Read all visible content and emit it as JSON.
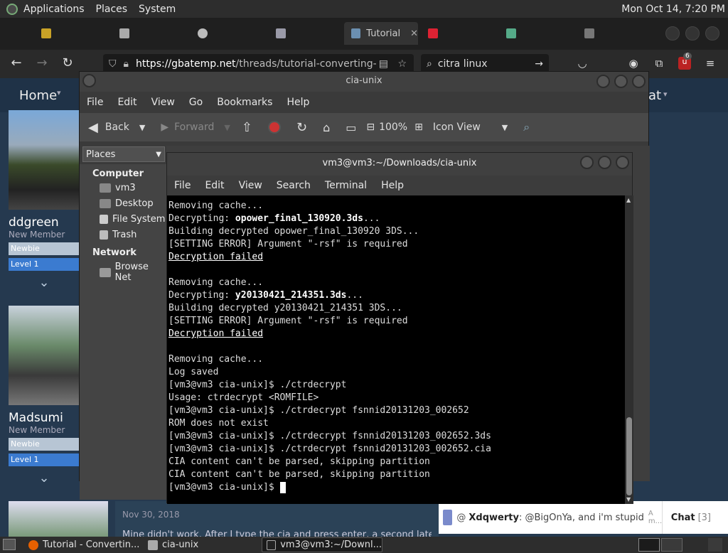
{
  "panel": {
    "menus": [
      "Applications",
      "Places",
      "System"
    ],
    "clock": "Mon Oct 14,  7:20 PM"
  },
  "browser": {
    "active_tab_label": "Tutorial",
    "url_host": "https://gbatemp.net",
    "url_path": "/threads/tutorial-converting-",
    "search_text": "citra linux",
    "notification_count": "6"
  },
  "forum": {
    "nav_home": "Home",
    "nav_right": "at",
    "members": [
      {
        "name": "ddgreen",
        "role": "New Member",
        "badge1": "Newbie",
        "badge2": "Level 1"
      },
      {
        "name": "Madsumi",
        "role": "New Member",
        "badge1": "Newbie",
        "badge2": "Level 1"
      }
    ],
    "post_date": "Nov 30, 2018",
    "post_text": "Mine didn't work. After I type the cia and press enter, a second later it ap",
    "chat_user": "Xdqwerty",
    "chat_msg": ": @BigOnYa, and i'm stupid",
    "chat_time": "A m...",
    "chat_label": "Chat",
    "chat_count": "[3]"
  },
  "file_manager": {
    "title": "cia-unix",
    "menus": [
      "File",
      "Edit",
      "View",
      "Go",
      "Bookmarks",
      "Help"
    ],
    "toolbar": {
      "back": "Back",
      "forward": "Forward",
      "zoom": "100%",
      "view_mode": "Icon View"
    },
    "places_label": "Places",
    "sidebar": {
      "computer_header": "Computer",
      "computer_items": [
        "vm3",
        "Desktop",
        "File System",
        "Trash"
      ],
      "network_header": "Network",
      "network_items": [
        "Browse Net"
      ]
    }
  },
  "terminal": {
    "title": "vm3@vm3:~/Downloads/cia-unix",
    "menus": [
      "File",
      "Edit",
      "View",
      "Search",
      "Terminal",
      "Help"
    ],
    "lines": [
      {
        "pre": "Removing cache...",
        "bold": "",
        "post": ""
      },
      {
        "pre": "Decrypting: ",
        "bold": "opower_final_130920.3ds",
        "post": "..."
      },
      {
        "pre": "Building decrypted opower_final_130920 3DS...",
        "bold": "",
        "post": ""
      },
      {
        "pre": "[SETTING ERROR] Argument \"-rsf\" is required",
        "bold": "",
        "post": ""
      },
      {
        "pre": "",
        "bold": "",
        "post": "",
        "underline": "Decryption failed"
      },
      {
        "pre": "",
        "bold": "",
        "post": ""
      },
      {
        "pre": "Removing cache...",
        "bold": "",
        "post": ""
      },
      {
        "pre": "Decrypting: ",
        "bold": "y20130421_214351.3ds",
        "post": "..."
      },
      {
        "pre": "Building decrypted y20130421_214351 3DS...",
        "bold": "",
        "post": ""
      },
      {
        "pre": "[SETTING ERROR] Argument \"-rsf\" is required",
        "bold": "",
        "post": ""
      },
      {
        "pre": "",
        "bold": "",
        "post": "",
        "underline": "Decryption failed"
      },
      {
        "pre": "",
        "bold": "",
        "post": ""
      },
      {
        "pre": "Removing cache...",
        "bold": "",
        "post": ""
      },
      {
        "pre": "Log saved",
        "bold": "",
        "post": ""
      },
      {
        "pre": "[vm3@vm3 cia-unix]$ ./ctrdecrypt",
        "bold": "",
        "post": ""
      },
      {
        "pre": "Usage: ctrdecrypt <ROMFILE>",
        "bold": "",
        "post": ""
      },
      {
        "pre": "[vm3@vm3 cia-unix]$ ./ctrdecrypt fsnnid20131203_002652",
        "bold": "",
        "post": ""
      },
      {
        "pre": "ROM does not exist",
        "bold": "",
        "post": ""
      },
      {
        "pre": "[vm3@vm3 cia-unix]$ ./ctrdecrypt fsnnid20131203_002652.3ds",
        "bold": "",
        "post": ""
      },
      {
        "pre": "[vm3@vm3 cia-unix]$ ./ctrdecrypt fsnnid20131203_002652.cia",
        "bold": "",
        "post": ""
      },
      {
        "pre": "CIA content can't be parsed, skipping partition",
        "bold": "",
        "post": ""
      },
      {
        "pre": "CIA content can't be parsed, skipping partition",
        "bold": "",
        "post": ""
      },
      {
        "pre": "[vm3@vm3 cia-unix]$ ",
        "bold": "",
        "post": "",
        "cursor": true
      }
    ]
  },
  "taskbar": {
    "items": [
      "Tutorial - Convertin...",
      "cia-unix",
      "vm3@vm3:~/Downl..."
    ]
  }
}
